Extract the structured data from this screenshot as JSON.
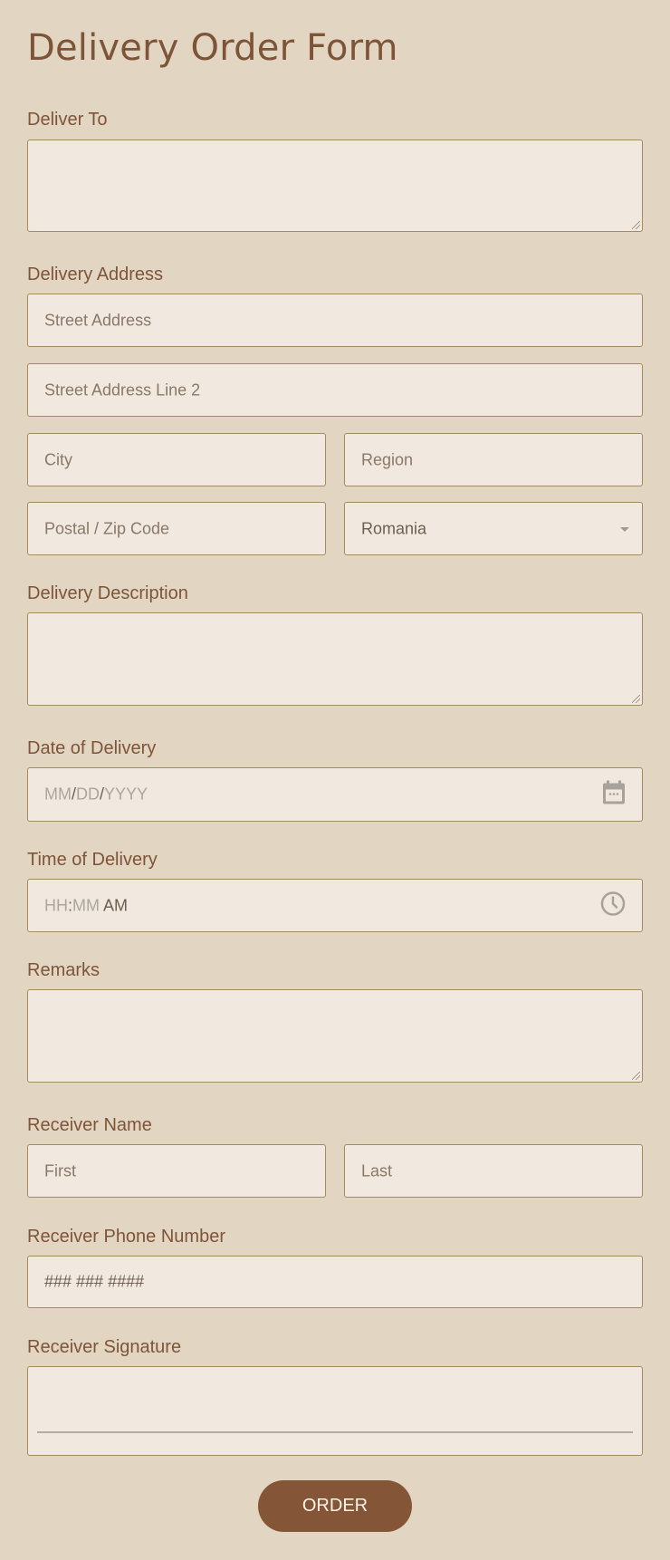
{
  "form": {
    "title": "Delivery Order Form",
    "deliver_to": {
      "label": "Deliver To",
      "value": ""
    },
    "address": {
      "label": "Delivery Address",
      "street": "Street Address",
      "street2": "Street Address Line 2",
      "city": "City",
      "region": "Region",
      "postal": "Postal / Zip Code",
      "country": "Romania"
    },
    "description": {
      "label": "Delivery Description",
      "value": ""
    },
    "date": {
      "label": "Date of Delivery",
      "mm": "MM",
      "dd": "DD",
      "yyyy": "YYYY",
      "sep": "/",
      "icon": "calendar-icon"
    },
    "time": {
      "label": "Time of Delivery",
      "hh": "HH",
      "colon": ":",
      "mm": "MM",
      "ampm": "AM",
      "icon": "clock-icon"
    },
    "remarks": {
      "label": "Remarks",
      "value": ""
    },
    "receiver_name": {
      "label": "Receiver Name",
      "first": "First",
      "last": "Last"
    },
    "phone": {
      "label": "Receiver Phone Number",
      "placeholder": "### ### ####"
    },
    "signature": {
      "label": "Receiver Signature"
    },
    "submit_label": "ORDER"
  },
  "colors": {
    "background": "#e2d6c3",
    "field": "#f1e9df",
    "border": "#a48a62",
    "accent": "#845537",
    "text": "#7e5439"
  }
}
